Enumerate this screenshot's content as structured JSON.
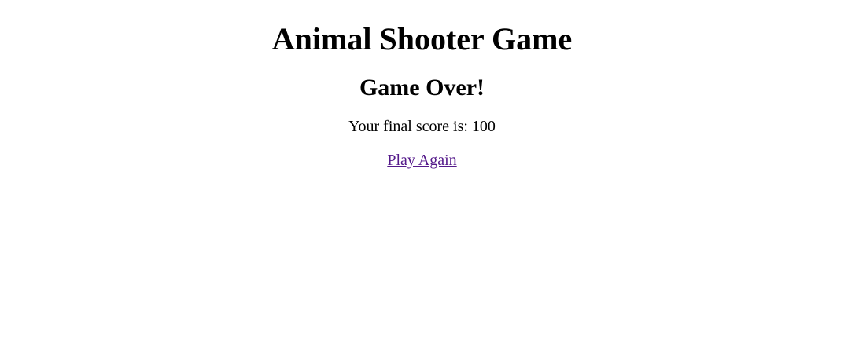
{
  "page": {
    "title": "Animal Shooter Game"
  },
  "result": {
    "heading": "Game Over!",
    "score_prefix": "Your final score is: ",
    "score": "100"
  },
  "actions": {
    "play_again_label": "Play Again",
    "link_color": "#551a8b"
  }
}
